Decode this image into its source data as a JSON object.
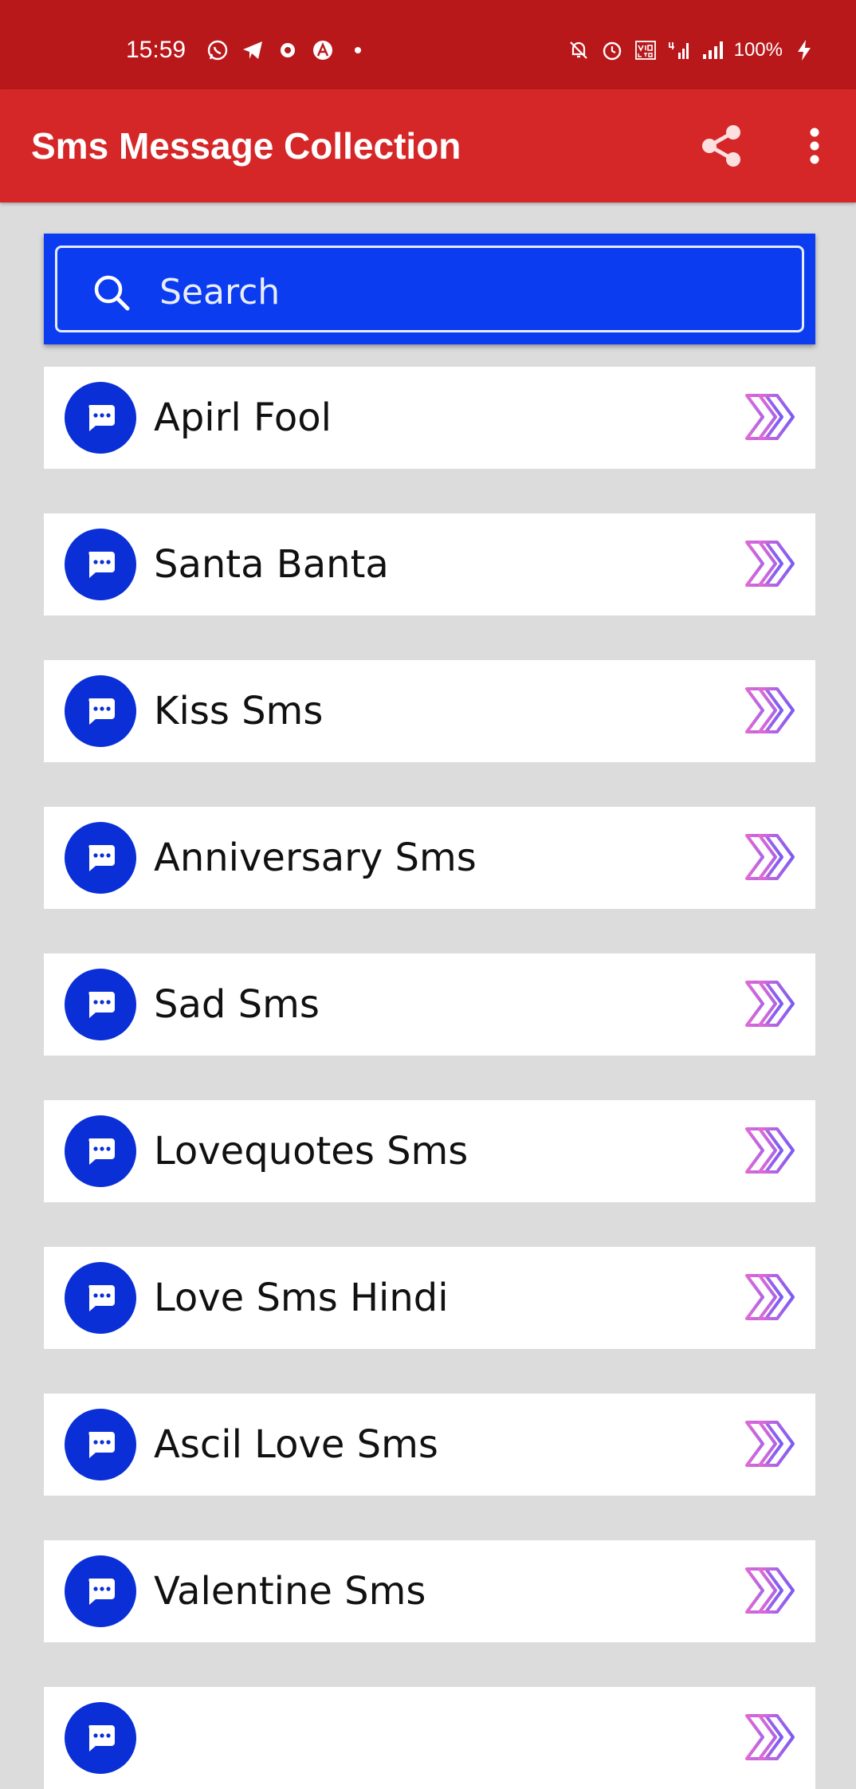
{
  "status_bar": {
    "time": "15:59",
    "battery": "100%",
    "left_icons": [
      "whatsapp-icon",
      "telegram-icon",
      "app-notification-icon",
      "arc-icon",
      "dot-icon"
    ],
    "right_icons": [
      "mute-icon",
      "alarm-icon",
      "volte-icon",
      "signal-4g-icon",
      "signal-icon",
      "charging-icon"
    ]
  },
  "app_bar": {
    "title": "Sms Message Collection",
    "share_icon": "share-icon",
    "more_icon": "more-vert-icon"
  },
  "search": {
    "placeholder": "Search",
    "value": ""
  },
  "colors": {
    "status_bar": "#b9181b",
    "app_bar": "#d62728",
    "search_bg": "#0b3cf0",
    "avatar": "#0a2fd6",
    "arrow_start": "#e06ad6",
    "arrow_end": "#7b5cf2",
    "background": "#dcdcdc"
  },
  "categories": [
    {
      "label": "Apirl Fool"
    },
    {
      "label": "Santa Banta"
    },
    {
      "label": "Kiss Sms"
    },
    {
      "label": "Anniversary Sms"
    },
    {
      "label": "Sad Sms"
    },
    {
      "label": "Lovequotes Sms"
    },
    {
      "label": "Love Sms Hindi"
    },
    {
      "label": "Ascil Love Sms"
    },
    {
      "label": "Valentine Sms"
    },
    {
      "label": ""
    }
  ]
}
